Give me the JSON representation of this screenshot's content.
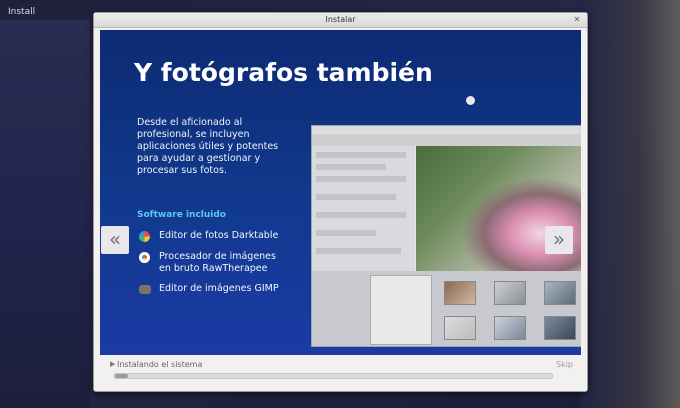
{
  "desktop": {
    "label": "Install"
  },
  "window": {
    "title": "Instalar"
  },
  "slide": {
    "title": "Y fotógrafos también",
    "description_lines": [
      "Desde el aficionado al",
      "profesional, se incluyen",
      "aplicaciones útiles y potentes",
      "para ayudar a gestionar y",
      "procesar sus fotos."
    ],
    "software_heading": "Software incluido",
    "software": [
      {
        "icon": "darktable-icon",
        "lines": [
          "Editor de fotos Darktable"
        ]
      },
      {
        "icon": "rawtherapee-icon",
        "lines": [
          "Procesador de imágenes",
          "en bruto RawTherapee"
        ]
      },
      {
        "icon": "gimp-icon",
        "lines": [
          "Editor de imágenes GIMP"
        ]
      }
    ],
    "prev_glyph": "«",
    "next_glyph": "»"
  },
  "progress": {
    "label": "Instalando el sistema",
    "skip_label": "Skip",
    "fraction": 0.03
  }
}
